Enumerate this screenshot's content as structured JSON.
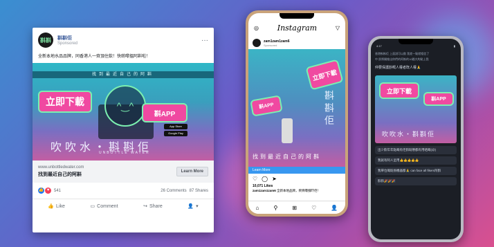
{
  "fb": {
    "page_name": "斟斟佢",
    "sponsored": "Sponsored",
    "more": "···",
    "logo_text": "斟斟",
    "post_text": "全新本地水品品牌，同香港人一齊頂住飲！快啲嚟搵阿斟啦！",
    "ad": {
      "bar_text": "找到最近自己的阿斟",
      "bubble_left": "立即下載",
      "bubble_right": "斟APP",
      "store1": "App Store",
      "store2": "Google Play",
      "big_text": "吹吹水・斟斟佢",
      "sub_text": "UNBOTTLE WATER"
    },
    "link_url": "www.unbottledwater.com",
    "link_title": "找到最近自己的阿斟",
    "learn_more": "Learn More",
    "reaction_count": "541",
    "comments": "26 Comments",
    "shares": "87 Shares",
    "actions": {
      "like": "Like",
      "comment": "Comment",
      "share": "Share"
    }
  },
  "ig": {
    "logo": "Instagram",
    "username": "zam1zam1zam6",
    "sponsored": "Sponsored",
    "learn_more": "Learn More",
    "likes": "10,071 Likes",
    "caption_user": "zam1zam1zam6",
    "caption": "全新本地品牌，齊齊嚟撐吓佢！",
    "ad": {
      "bubble_top": "立即下載",
      "bubble_left": "斟APP",
      "bottom_text": "找到最近自己的阿斟",
      "vertical_text": "斟斟佢"
    }
  },
  "dark": {
    "time": "4:17",
    "header_line": "香港斟斟佢 上面說可以飲 我差一點就相信了",
    "line2": "中 即將開推出你們的阿斟的10間大約點上我",
    "question": "仲要保護斟嘅人權者既人權🙏",
    "ad": {
      "bubble_left": "立即下載",
      "bubble_right": "斟APP",
      "bottom_text": "吹吹水・斟斟佢"
    },
    "chats": [
      "出少飲年年點嘅有佢斟既嘢都有用哂嘅(@)",
      "我就有阿人呈用👍👍👍👍👍",
      "我單位嘅既係機器都🙏 can face all fikers阿斟",
      "斟斟🎉🎉🎉"
    ]
  },
  "colors": {
    "pink": "#f049a1",
    "mint": "#7cf0b0",
    "fb_blue": "#385898"
  }
}
